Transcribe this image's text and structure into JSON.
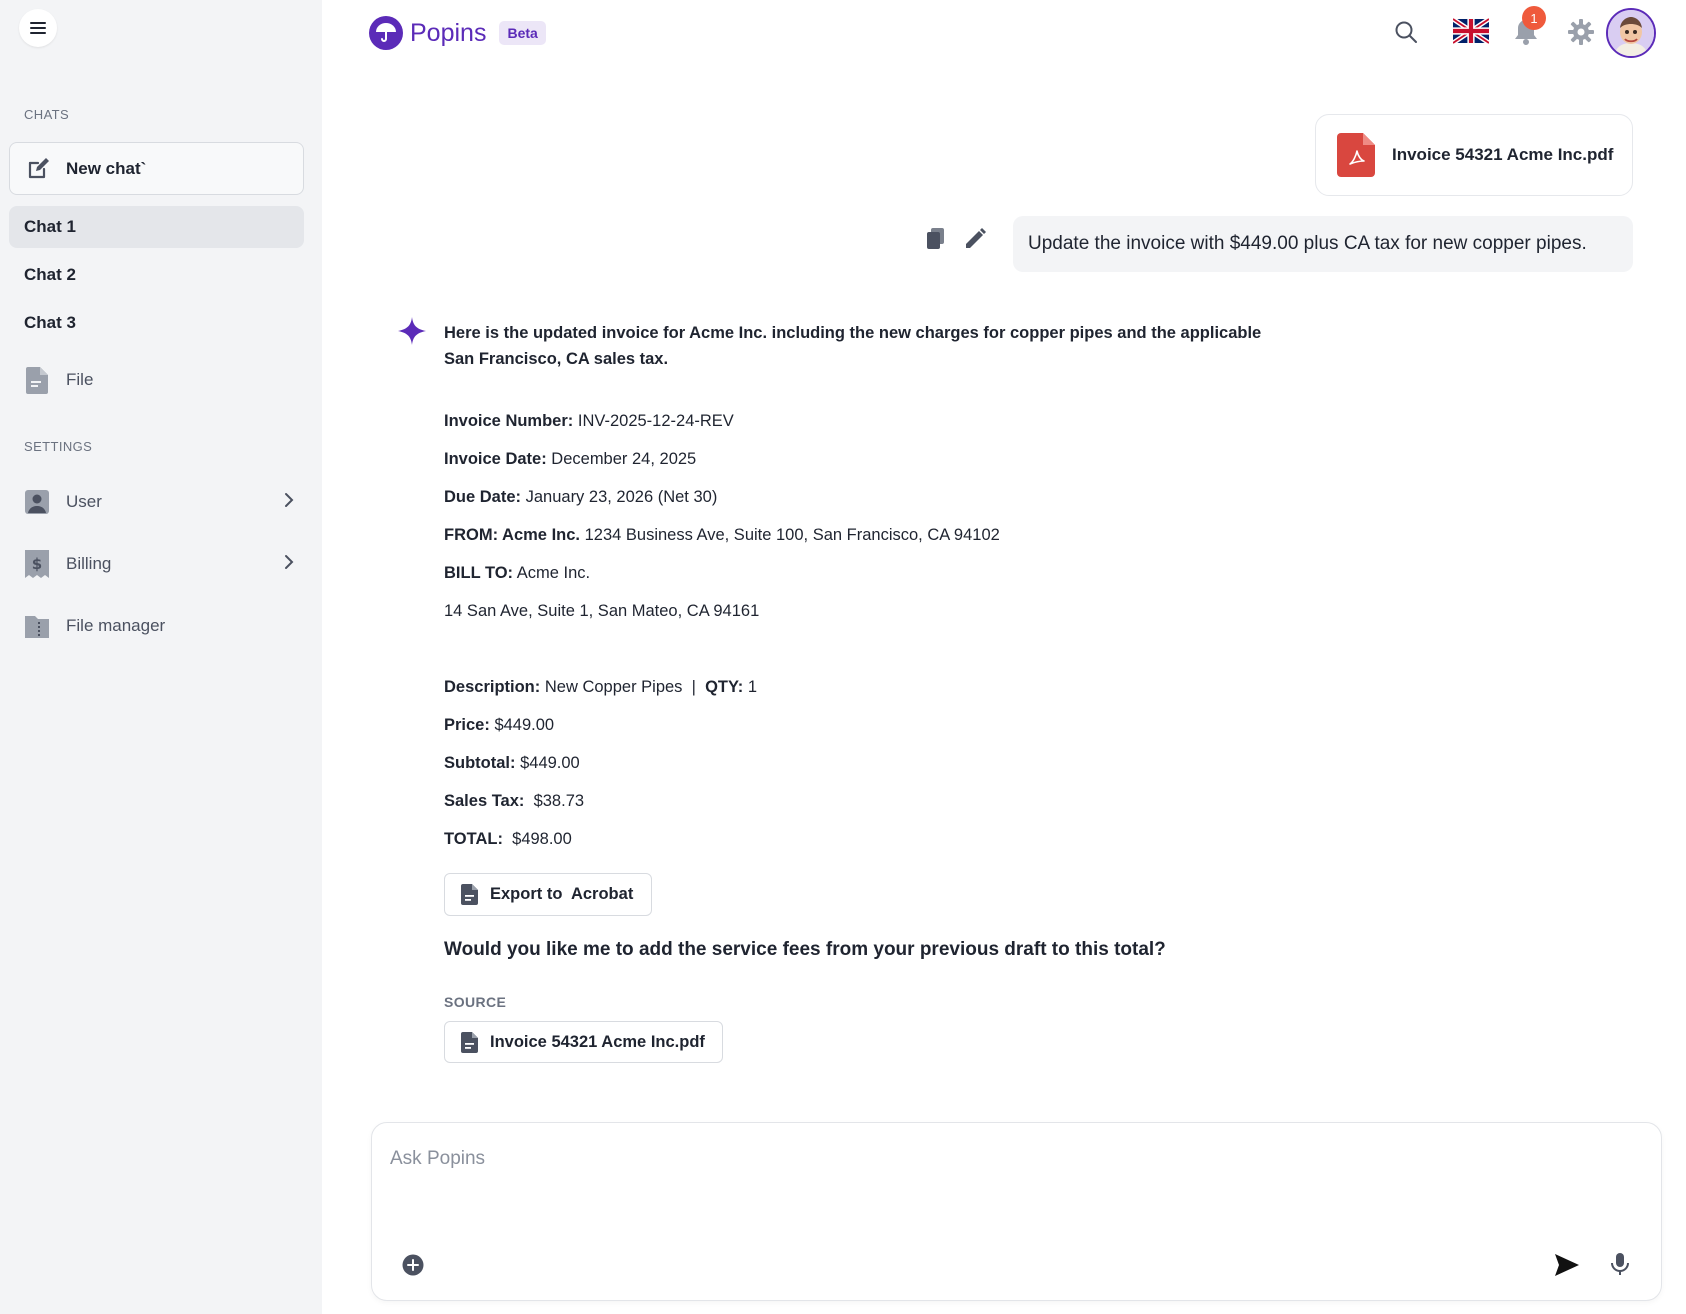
{
  "app": {
    "name": "Popins",
    "badge": "Beta"
  },
  "sidebar": {
    "chats_label": "CHATS",
    "new_chat": "New chat`",
    "chats": [
      {
        "label": "Chat 1",
        "active": true
      },
      {
        "label": "Chat 2",
        "active": false
      },
      {
        "label": "Chat 3",
        "active": false
      }
    ],
    "file": "File",
    "settings_label": "SETTINGS",
    "settings": [
      {
        "label": "User",
        "icon": "user-icon"
      },
      {
        "label": "Billing",
        "icon": "billing-icon"
      },
      {
        "label": "File manager",
        "icon": "folder-icon"
      }
    ]
  },
  "header": {
    "notifications": "1",
    "language": "English (UK)"
  },
  "conversation": {
    "attachment": "Invoice 54321 Acme Inc.pdf",
    "user_message": "Update the invoice with $449.00 plus CA tax for new copper pipes.",
    "assistant_intro": "Here is the updated invoice for Acme Inc. including the new charges for copper pipes and the applicable San Francisco, CA sales tax.",
    "invoice": {
      "number_label": "Invoice Number:",
      "number": "INV-2025-12-24-REV",
      "date_label": "Invoice Date:",
      "date": "December 24, 2025",
      "due_label": "Due Date:",
      "due": "January 23, 2026 (Net 30)",
      "from_label": "FROM: Acme Inc.",
      "from": "1234 Business Ave, Suite 100, San Francisco, CA 94102",
      "bill_label": "BILL TO:",
      "bill": "Acme Inc.",
      "bill_address": "14 San Ave, Suite 1, San Mateo, CA 94161",
      "desc_label": "Description:",
      "desc": "New Copper Pipes",
      "qty_label": "QTY:",
      "qty": "1",
      "price_label": "Price:",
      "price": "$449.00",
      "subtotal_label": "Subtotal:",
      "subtotal": "$449.00",
      "tax_label": "Sales Tax:",
      "tax": "$38.73",
      "total_label": "TOTAL:",
      "total": "$498.00"
    },
    "export_button": "Export to  Acrobat",
    "question": "Would you like me to add the service fees from your previous draft to this total?",
    "source_label": "SOURCE",
    "source_file": "Invoice 54321 Acme Inc.pdf"
  },
  "composer": {
    "placeholder": "Ask Popins"
  },
  "colors": {
    "brand": "#5b2bb8",
    "pdf": "#d9473f",
    "notification": "#ef5a3c"
  }
}
